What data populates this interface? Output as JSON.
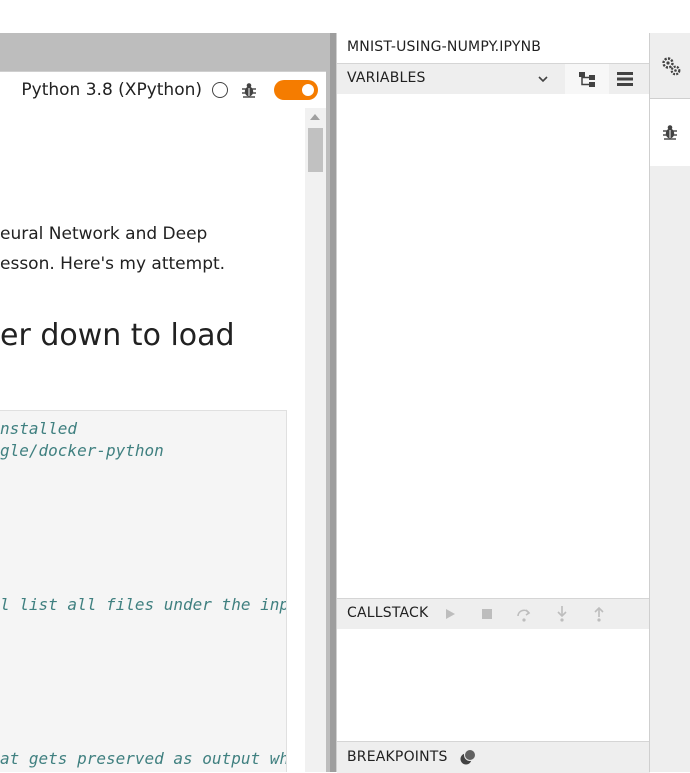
{
  "notebook": {
    "kernel_name": "Python 3.8 (XPython)",
    "markdown_line1": "eural Network and Deep",
    "markdown_line2": "esson. Here's my attempt.",
    "heading": "er down to load",
    "code_lines": [
      "nstalled",
      "gle/docker-python",
      "l list all files under the inp",
      "at gets preserved as output wh"
    ]
  },
  "debugger": {
    "title": "MNIST-USING-NUMPY.IPYNB",
    "variables_label": "VARIABLES",
    "callstack_label": "CALLSTACK",
    "breakpoints_label": "BREAKPOINTS"
  },
  "colors": {
    "toggle_on": "#f57c00",
    "code_comment": "#408080",
    "panel_header_bg": "#eeeeee"
  },
  "icons": {
    "kernel_status": "circle-icon",
    "kernel_debug": "bug-icon",
    "variables_expand": "chevron-down-icon",
    "variables_tree": "tree-view-icon",
    "variables_table": "table-view-icon",
    "callstack": [
      "play-icon",
      "stop-icon",
      "step-over-icon",
      "step-into-icon",
      "step-out-icon"
    ],
    "breakpoints": "breakpoints-icon",
    "sidebar": [
      "gears-icon",
      "bug-icon"
    ]
  }
}
